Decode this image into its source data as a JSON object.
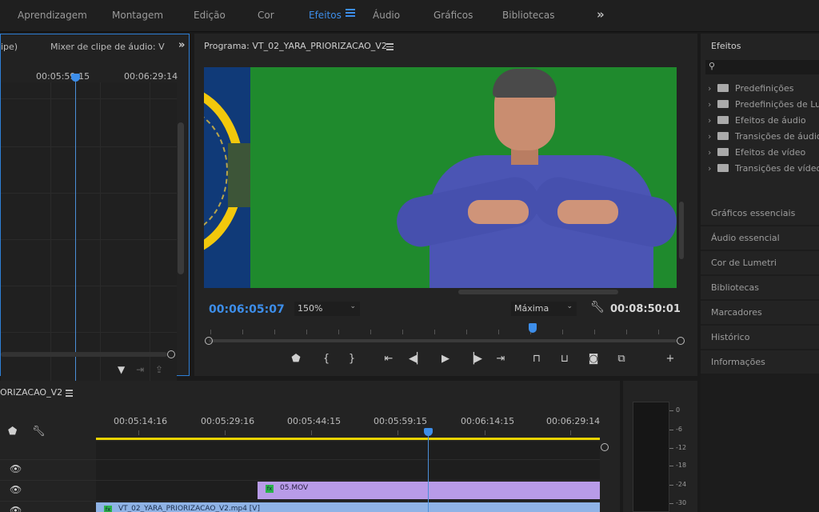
{
  "workspaces": {
    "items": [
      "Aprendizagem",
      "Montagem",
      "Edição",
      "Cor",
      "Efeitos",
      "Áudio",
      "Gráficos",
      "Bibliotecas"
    ],
    "active": "Efeitos",
    "more_icon": "chevron-double-right-icon"
  },
  "left_panel": {
    "tab_source": "ipe)",
    "tab_mixer": "Mixer de clipe de áudio: V",
    "time_1": "00:05:59:15",
    "time_2": "00:06:29:14"
  },
  "program": {
    "title": "Programa: VT_02_YARA_PRIORIZACAO_V2",
    "timecode": "00:06:05:07",
    "zoom": "150%",
    "quality": "Máxima",
    "duration": "00:08:50:01",
    "playhead_fraction": 0.69
  },
  "effects": {
    "title": "Efeitos",
    "search_placeholder": "",
    "tree": [
      "Predefinições",
      "Predefinições de Lu",
      "Efeitos de áudio",
      "Transições de áudio",
      "Efeitos de vídeo",
      "Transições de vídeo"
    ]
  },
  "right_panels": [
    "Gráficos essenciais",
    "Áudio essencial",
    "Cor de Lumetri",
    "Bibliotecas",
    "Marcadores",
    "Histórico",
    "Informações"
  ],
  "timeline": {
    "title": "ORIZACAO_V2",
    "ruler": [
      "00:05:14:16",
      "00:05:29:16",
      "00:05:44:15",
      "00:05:59:15",
      "00:06:14:15",
      "00:06:29:14"
    ],
    "clips": [
      {
        "label": "05.MOV",
        "track": "V2",
        "color": "#b89be8"
      },
      {
        "label": "VT_02_YARA_PRIORIZACAO_V2.mp4 [V]",
        "track": "V1",
        "color": "#8fb3e6"
      }
    ]
  },
  "audio_meter": {
    "scale": [
      "0",
      "-6",
      "-12",
      "-18",
      "-24",
      "-30"
    ]
  },
  "colors": {
    "accent": "#3d8eea",
    "work_area": "#e8d300",
    "chroma_green": "#1f8a2d"
  }
}
